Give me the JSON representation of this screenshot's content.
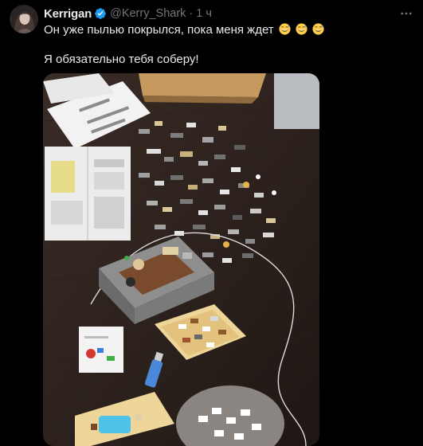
{
  "post": {
    "author": {
      "display_name": "Kerrigan",
      "handle": "@Kerry_Shark",
      "verified": true,
      "avatar_icon": "avatar-photo"
    },
    "separator": "·",
    "timestamp": "1 ч",
    "more_icon": "more-horizontal-icon",
    "text_line1": "Он уже пылью покрылся, пока меня ждет",
    "emojis": [
      "grinning-sweat-emoji",
      "grinning-sweat-emoji",
      "grinning-sweat-emoji"
    ],
    "text_line2": "Я обязательно тебя соберу!",
    "media": {
      "type": "photo",
      "subject": "lego-pieces-on-table"
    }
  },
  "colors": {
    "background": "#000000",
    "text_primary": "#e7e9ea",
    "text_secondary": "#71767b",
    "verified_blue": "#1d9bf0",
    "emoji_yellow": "#ffcc4d"
  }
}
